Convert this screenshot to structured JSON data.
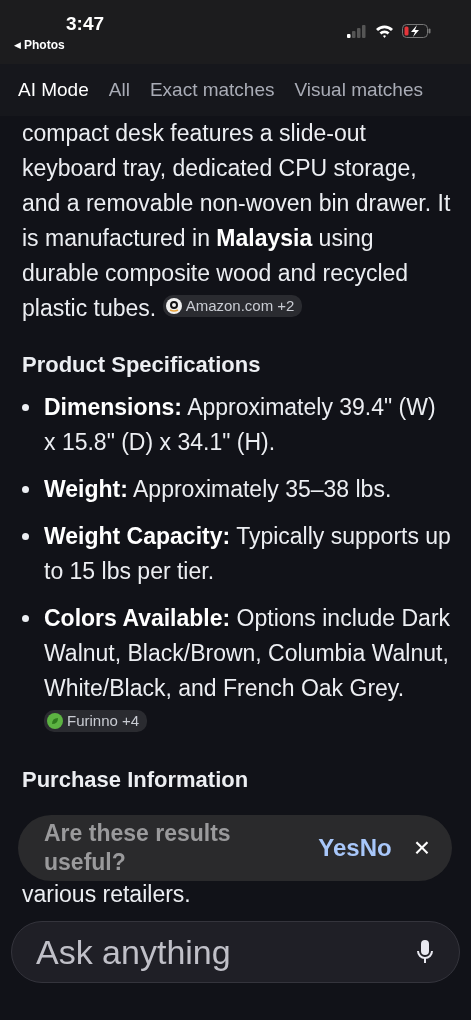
{
  "status_bar": {
    "time": "3:47",
    "back_arrow": "◀",
    "back_label": "Photos"
  },
  "tabs": [
    {
      "label": "AI Mode",
      "selected": true
    },
    {
      "label": "All",
      "selected": false
    },
    {
      "label": "Exact matches",
      "selected": false
    },
    {
      "label": "Visual matches",
      "selected": false
    }
  ],
  "answer": {
    "intro": {
      "text": "compact desk features a slide-out keyboard tray, dedicated CPU storage, and a removable non-woven bin drawer. It is manufactured in **Malaysia** using durable composite wood and recycled plastic tubes.",
      "citation": {
        "kind": "amazon",
        "label": "Amazon.com +2"
      }
    },
    "sections": [
      {
        "heading": "Product Specifications",
        "bullets": [
          {
            "text": "**Dimensions:** Approximately 39.4\" (W) x 15.8\" (D) x 34.1\" (H)."
          },
          {
            "text": "**Weight:** Approximately 35–38 lbs."
          },
          {
            "text": "**Weight Capacity:** Typically supports up to 15 lbs per tier."
          },
          {
            "text": "**Colors Available:** Options include Dark Walnut, Black/Brown, Columbia Walnut, White/Black, and French Oak Grey.",
            "citation": {
              "kind": "leaf",
              "label": "Furinno +4"
            }
          }
        ]
      },
      {
        "heading": "Purchase Information",
        "paragraph": "various retailers."
      }
    ]
  },
  "feedback_toast": {
    "question": "Are these results useful?",
    "yes": "Yes",
    "no": "No",
    "close": "×"
  },
  "search": {
    "placeholder": "Ask anything"
  }
}
